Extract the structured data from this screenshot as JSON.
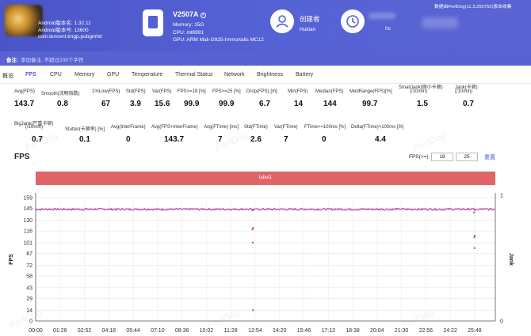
{
  "app": {
    "line1": "Android版本名: 1.32.11",
    "line2": "Android版本号: 13600",
    "package": "com.tencent.tmgp.pubgmhd",
    "icon": "app-icon"
  },
  "device": {
    "name": "V2507A",
    "memory": "Memory: 15G",
    "cpu": "CPU: mt6991",
    "gpu": "GPU: ARM Mali-G925-Immortalis MC12",
    "icon": "phone-icon",
    "info_icon": "i"
  },
  "creator": {
    "label": "创建者",
    "name": "Huitian",
    "icon": "user-icon"
  },
  "timer": {
    "duration_suffix": "0s",
    "icon": "clock-icon"
  },
  "data_source": "数据由PerfDog(11.3.250752)版本收集",
  "note": {
    "label": "备注:",
    "placeholder": "添加备注, 不超过200个字符"
  },
  "tabs": [
    "概览",
    "FPS",
    "CPU",
    "Memory",
    "GPU",
    "Temperature",
    "Thermal Status",
    "Network",
    "Brightness",
    "Battery"
  ],
  "active_tab": "FPS",
  "stats_row1": [
    {
      "label": "Avg(FPS)",
      "value": "143.7"
    },
    {
      "label": "Smooth(流畅指数)",
      "value": "0.8"
    },
    {
      "label": "1%Low(FPS)",
      "value": "67"
    },
    {
      "label": "Std(FPS)",
      "value": "3.9"
    },
    {
      "label": "Var(FPS)",
      "value": "15.6"
    },
    {
      "label": "FPS>=18 [%]",
      "value": "99.9"
    },
    {
      "label": "FPS>=25 [%]",
      "value": "99.9"
    },
    {
      "label": "Drop(FPS) [/h]",
      "value": "6.7"
    },
    {
      "label": "Min(FPS)",
      "value": "14"
    },
    {
      "label": "Median(FPS)",
      "value": "144"
    },
    {
      "label": "MedRange(FPS)[%]",
      "value": "99.7"
    },
    {
      "label": "SmallJank(微小卡顿)",
      "label2": "(/10min)",
      "value": "1.5"
    },
    {
      "label": "Jank(卡顿)",
      "label2": "(/10min)",
      "value": "0.7"
    }
  ],
  "stats_row2": [
    {
      "label": "BigJank(严重卡顿)",
      "label2": "(/10min)",
      "value": "0.7"
    },
    {
      "label": "Stutter(卡顿率) [%]",
      "value": "0.1"
    },
    {
      "label": "Avg(InterFrame)",
      "value": "0"
    },
    {
      "label": "Avg(FPS+InterFrame)",
      "value": "143.7"
    },
    {
      "label": "Avg(FTime) [ms]",
      "value": "7"
    },
    {
      "label": "Std(FTime)",
      "value": "2.6"
    },
    {
      "label": "Var(FTime)",
      "value": "7"
    },
    {
      "label": "FTime>=100ms [%]",
      "value": "0"
    },
    {
      "label": "Delta(FTime)>100ms [/h]",
      "value": "4.4"
    }
  ],
  "watermark": "PerfDog",
  "fps_section": {
    "title": "FPS",
    "threshold_label": "FPS(>=)",
    "threshold_values": [
      "18",
      "25"
    ],
    "reset_label": "重置",
    "label_bar": "label1"
  },
  "chart_data": {
    "type": "line",
    "title": "",
    "ylabel": "FPS",
    "y2label": "Jank",
    "ylim": [
      0,
      159
    ],
    "y_ticks": [
      0,
      14,
      29,
      43,
      58,
      72,
      87,
      101,
      116,
      130,
      145,
      159
    ],
    "y2_ticks": [
      0,
      1
    ],
    "x_ticks": [
      "00:00",
      "01:26",
      "02:52",
      "04:18",
      "05:44",
      "07:10",
      "08:36",
      "10:02",
      "11:28",
      "12:54",
      "14:20",
      "15:46",
      "17:12",
      "18:38",
      "20:04",
      "21:30",
      "22:56",
      "24:22",
      "25:48"
    ],
    "x_tick_seconds": [
      0,
      86,
      172,
      258,
      344,
      430,
      516,
      602,
      688,
      774,
      860,
      946,
      1032,
      1118,
      1204,
      1290,
      1376,
      1462,
      1548
    ],
    "duration_seconds": 1621,
    "grid": true,
    "series": [
      {
        "name": "",
        "baseline": 144,
        "dips": [
          {
            "t": 764,
            "values": [
              143,
              118,
              101,
              14,
              120,
              143
            ]
          },
          {
            "t": 1546,
            "values": [
              140,
              108,
              94,
              110,
              143
            ]
          }
        ],
        "color": "#b84fb0"
      }
    ]
  },
  "colors": {
    "header": "#5260d4",
    "accent": "#4f5bd5",
    "label_bar": "#e06566",
    "series": "#b84fb0"
  }
}
